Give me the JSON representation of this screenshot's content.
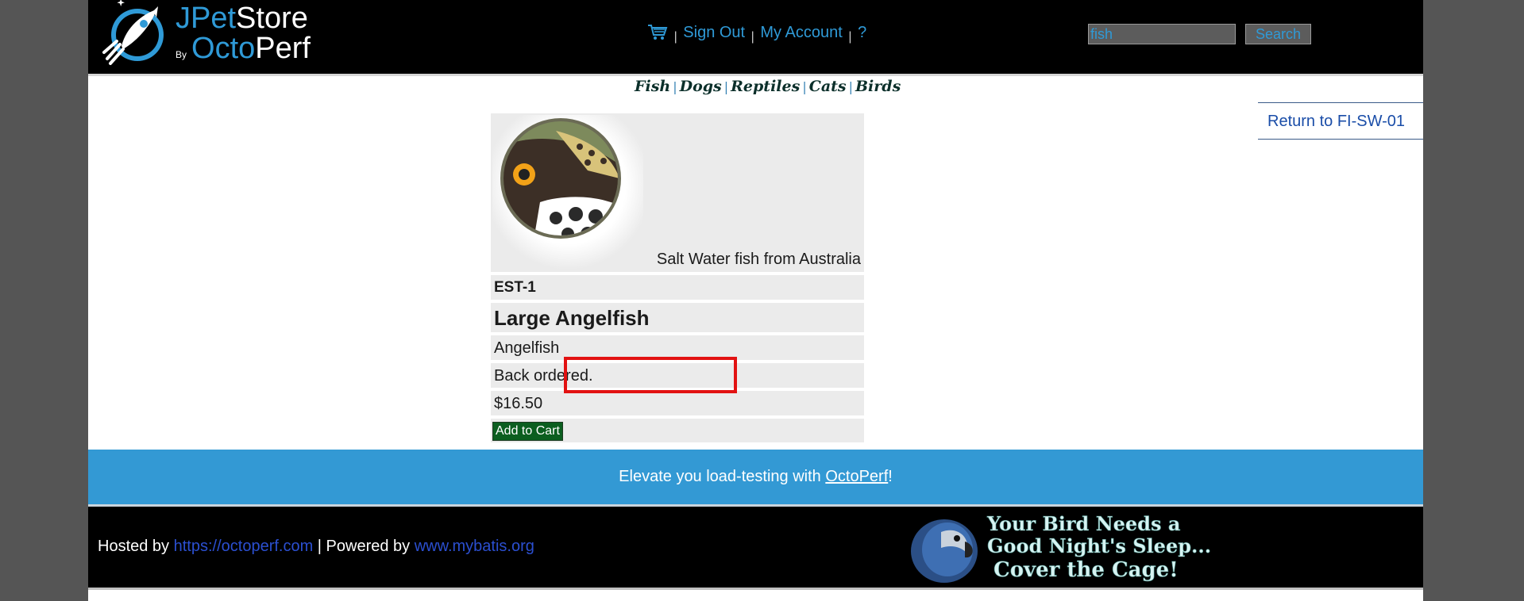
{
  "brand": {
    "logo_line1_a": "JPet",
    "logo_line1_b": "Store",
    "logo_by": "By",
    "logo_line2_a": "Octo",
    "logo_line2_b": "Perf"
  },
  "menu": {
    "cart_icon": "shopping-cart-icon",
    "sep1": "|",
    "sign_out": "Sign Out",
    "sep2": "|",
    "my_account": "My Account",
    "sep3": "|",
    "help": "?"
  },
  "search": {
    "value": "fish",
    "button_label": "Search"
  },
  "quicklinks": {
    "fish": "Fish",
    "dogs": "Dogs",
    "reptiles": "Reptiles",
    "cats": "Cats",
    "birds": "Birds",
    "sep": "|"
  },
  "back_link": "Return to FI-SW-01",
  "item": {
    "image_icon": "angelfish-image",
    "description": "Salt Water fish from Australia",
    "code": "EST-1",
    "name": "Large Angelfish",
    "product": "Angelfish",
    "stock": "Back ordered.",
    "price": "$16.50",
    "add_to_cart": "Add to Cart"
  },
  "promo": {
    "text_before": "Elevate you load-testing with ",
    "link": "OctoPerf",
    "text_after": "!"
  },
  "footer": {
    "hosted_by": "Hosted by ",
    "hosted_link": "https://octoperf.com",
    "powered_by": " | Powered by ",
    "powered_link": "www.mybatis.org",
    "banner_line1": "Your Bird Needs a",
    "banner_line2": "Good Night's Sleep...",
    "banner_line3": "Cover the Cage!"
  },
  "colors": {
    "header_bg": "#000000",
    "link_blue": "#2f9ad7",
    "promo_bg": "#3399d4",
    "highlight": "#e21212",
    "cart_button": "#0b5e1f"
  }
}
